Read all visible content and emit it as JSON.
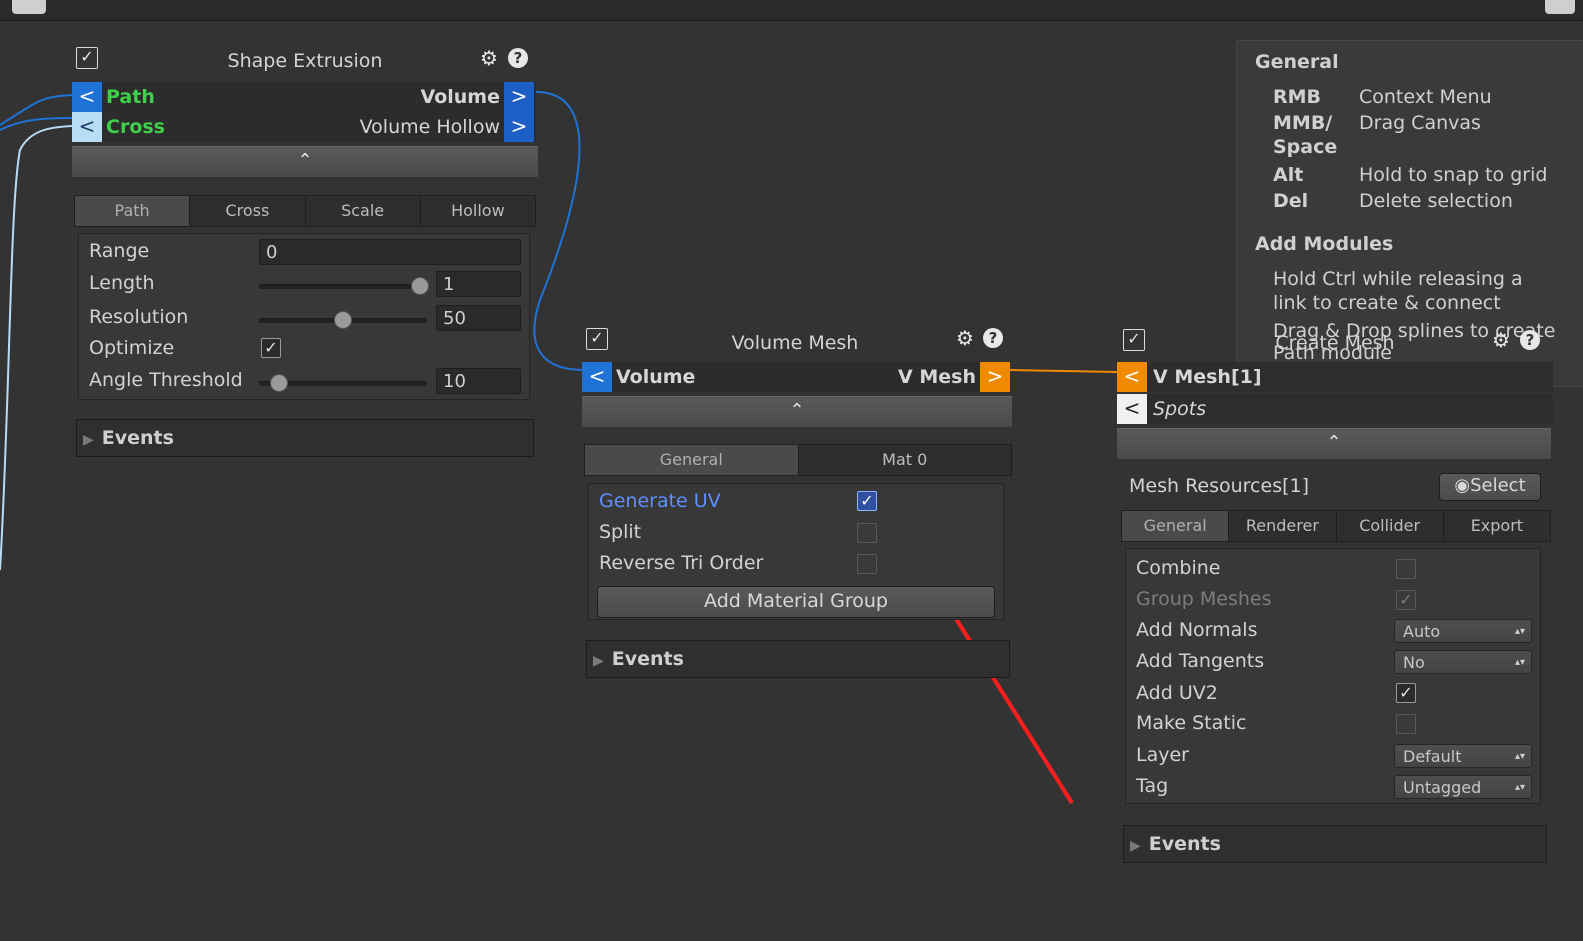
{
  "help": {
    "general_title": "General",
    "shortcuts": [
      {
        "key": "RMB",
        "action": "Context Menu"
      },
      {
        "key": "MMB/\nSpace",
        "action": "Drag Canvas"
      },
      {
        "key": "Alt",
        "action": "Hold to snap to grid"
      },
      {
        "key": "Del",
        "action": "Delete selection"
      }
    ],
    "add_modules_title": "Add Modules",
    "add_modules_text_1": "Hold Ctrl while releasing a",
    "add_modules_text_2": "link to create & connect",
    "drag_text": "Drag & Drop splines to create",
    "path_module_text": "Path module"
  },
  "shape_extrusion": {
    "title": "Shape Extrusion",
    "inputs": [
      {
        "arrow": "<",
        "label": "Path",
        "color": "#3ed04a"
      },
      {
        "arrow": "<",
        "label": "Cross",
        "color": "#3ed04a"
      }
    ],
    "outputs": [
      {
        "arrow": ">",
        "label": "Volume"
      },
      {
        "arrow": ">",
        "label": "Volume Hollow"
      }
    ],
    "collapse_glyph": "⌃",
    "tabs": [
      "Path",
      "Cross",
      "Scale",
      "Hollow"
    ],
    "active_tab": "Path",
    "fields": {
      "range_label": "Range",
      "range_value": "0",
      "length_label": "Length",
      "length_value": "1",
      "resolution_label": "Resolution",
      "resolution_value": "50",
      "optimize_label": "Optimize",
      "angle_label": "Angle Threshold",
      "angle_value": "10"
    },
    "events_label": "Events"
  },
  "volume_mesh": {
    "title": "Volume Mesh",
    "input": {
      "arrow": "<",
      "label": "Volume"
    },
    "output": {
      "arrow": ">",
      "label": "V Mesh"
    },
    "collapse_glyph": "⌃",
    "tabs": [
      "General",
      "Mat 0"
    ],
    "active_tab": "General",
    "generate_uv_label": "Generate UV",
    "split_label": "Split",
    "reverse_label": "Reverse Tri Order",
    "add_material_group_label": "Add Material Group",
    "events_label": "Events"
  },
  "create_mesh": {
    "title": "Create Mesh",
    "inputs": [
      {
        "arrow": "<",
        "label": "V Mesh[1]"
      },
      {
        "arrow": "<",
        "label": "Spots"
      }
    ],
    "collapse_glyph": "⌃",
    "mesh_resources_label": "Mesh Resources[1]",
    "select_label": "Select",
    "tabs": [
      "General",
      "Renderer",
      "Collider",
      "Export"
    ],
    "active_tab": "General",
    "combine_label": "Combine",
    "group_meshes_label": "Group Meshes",
    "add_normals_label": "Add Normals",
    "add_normals_value": "Auto",
    "add_tangents_label": "Add Tangents",
    "add_tangents_value": "No",
    "add_uv2_label": "Add UV2",
    "make_static_label": "Make Static",
    "layer_label": "Layer",
    "layer_value": "Default",
    "tag_label": "Tag",
    "tag_value": "Untagged",
    "events_label": "Events"
  },
  "icons": {
    "check": "✓",
    "gear": "⚙",
    "help": "?",
    "radio": "◉",
    "updown": "▴▾",
    "triangle": "▶"
  },
  "colors": {
    "accent_blue": "#1f73d6",
    "accent_orange": "#f08a00",
    "annotation_red": "#ff1e1e",
    "input_green": "#3ed04a"
  }
}
